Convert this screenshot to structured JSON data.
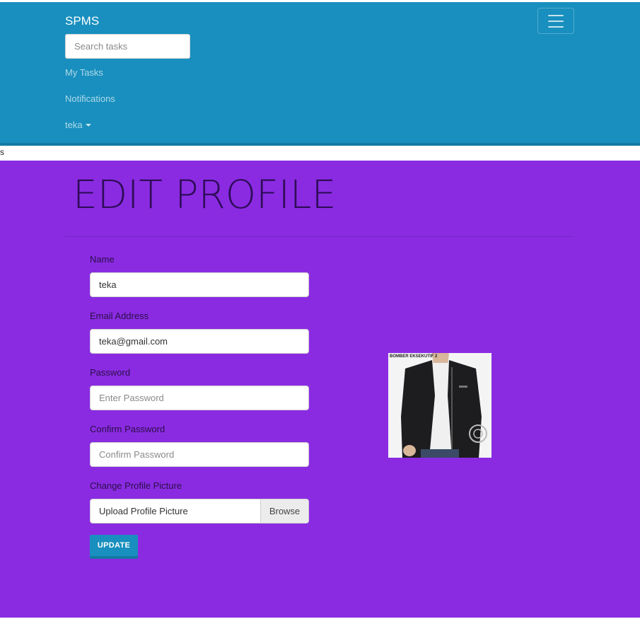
{
  "navbar": {
    "brand": "SPMS",
    "search_placeholder": "Search tasks",
    "links": {
      "tasks": "My Tasks",
      "notifications": "Notifications",
      "user": "teka"
    }
  },
  "stray_text": "s",
  "page": {
    "title": "EDIT PROFILE"
  },
  "form": {
    "name": {
      "label": "Name",
      "value": "teka"
    },
    "email": {
      "label": "Email Address",
      "value": "teka@gmail.com"
    },
    "password": {
      "label": "Password",
      "placeholder": "Enter Password"
    },
    "confirm_password": {
      "label": "Confirm Password",
      "placeholder": "Confirm Password"
    },
    "profile_picture": {
      "label": "Change Profile Picture",
      "text": "Upload Profile Picture",
      "browse": "Browse"
    },
    "submit": "UPDATE"
  },
  "profile_image": {
    "caption": "BOMBER EKSEKUTIF 2"
  },
  "colors": {
    "navbar": "#188fbe",
    "main_background": "#8a2be2",
    "title": "#2f0c58",
    "button": "#188fbe"
  }
}
